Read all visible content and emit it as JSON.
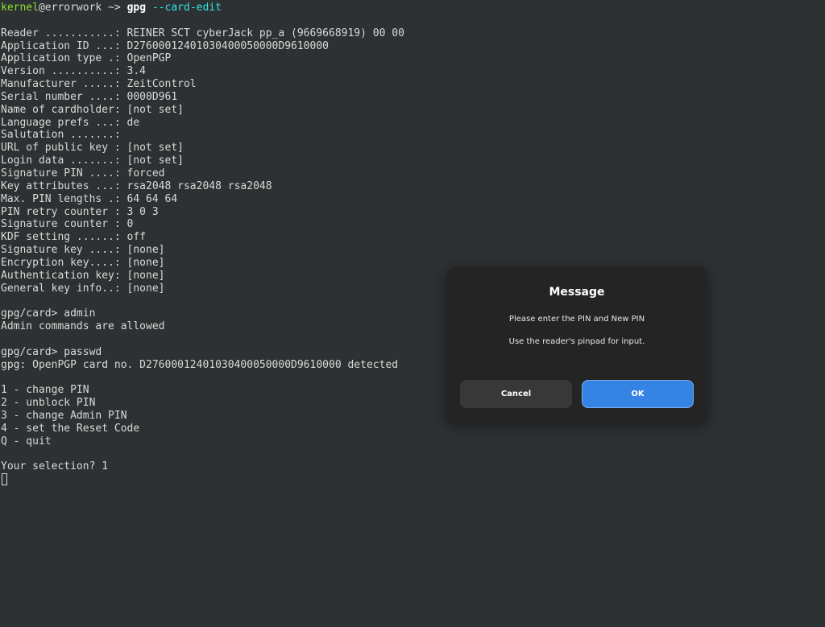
{
  "terminal": {
    "prompt": {
      "user": "kernel",
      "host": "@errorwork",
      "arrow": " ~> ",
      "command": "gpg",
      "args": " --card-edit"
    },
    "output_lines": [
      "",
      "Reader ...........: REINER SCT cyberJack pp_a (9669668919) 00 00",
      "Application ID ...: D27600012401030400050000D9610000",
      "Application type .: OpenPGP",
      "Version ..........: 3.4",
      "Manufacturer .....: ZeitControl",
      "Serial number ....: 0000D961",
      "Name of cardholder: [not set]",
      "Language prefs ...: de",
      "Salutation .......:",
      "URL of public key : [not set]",
      "Login data .......: [not set]",
      "Signature PIN ....: forced",
      "Key attributes ...: rsa2048 rsa2048 rsa2048",
      "Max. PIN lengths .: 64 64 64",
      "PIN retry counter : 3 0 3",
      "Signature counter : 0",
      "KDF setting ......: off",
      "Signature key ....: [none]",
      "Encryption key....: [none]",
      "Authentication key: [none]",
      "General key info..: [none]",
      "",
      "gpg/card> admin",
      "Admin commands are allowed",
      "",
      "gpg/card> passwd",
      "gpg: OpenPGP card no. D27600012401030400050000D9610000 detected",
      "",
      "1 - change PIN",
      "2 - unblock PIN",
      "3 - change Admin PIN",
      "4 - set the Reset Code",
      "Q - quit",
      "",
      "Your selection? 1"
    ]
  },
  "dialog": {
    "title": "Message",
    "line1": "Please enter the PIN and New PIN",
    "line2": "Use the reader's pinpad for input.",
    "cancel_label": "Cancel",
    "ok_label": "OK"
  }
}
